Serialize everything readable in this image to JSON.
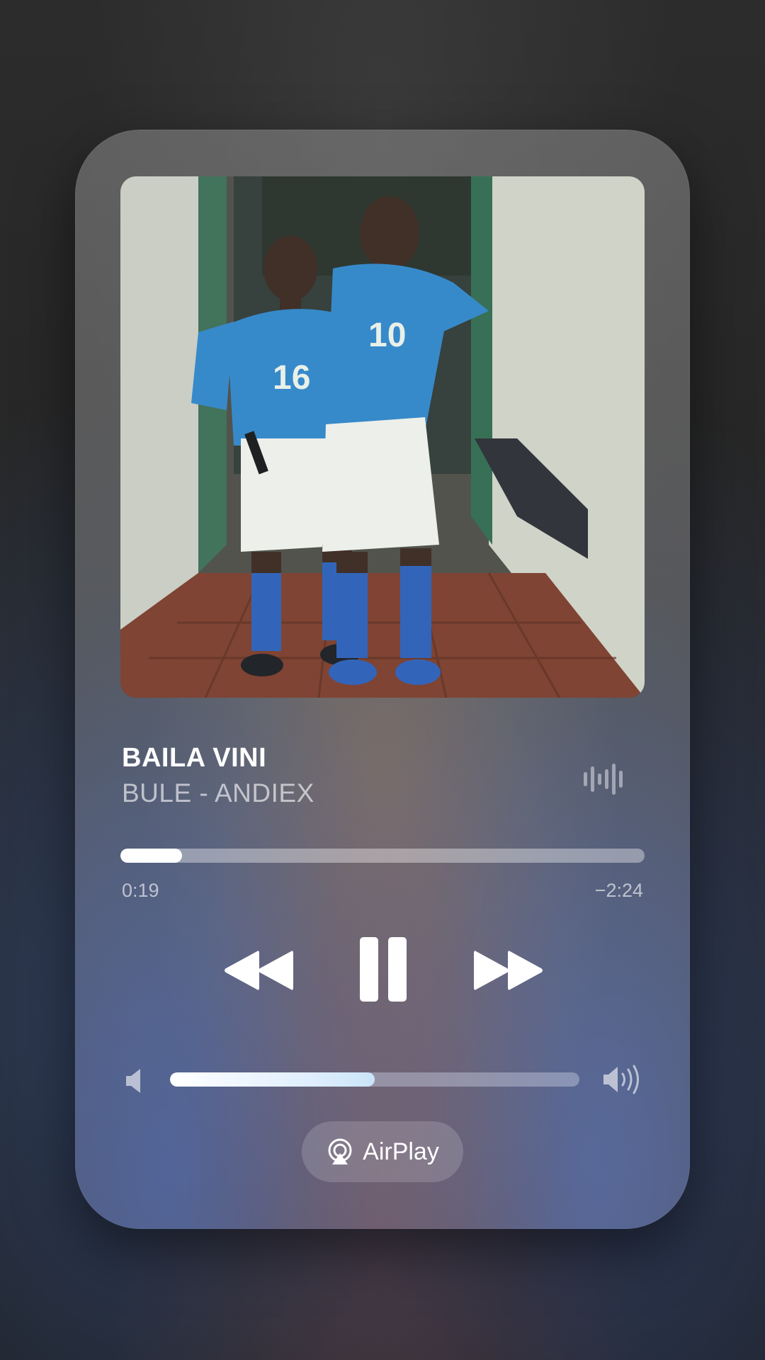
{
  "now_playing": {
    "title": "BAILA VINI",
    "artist": "BULE - ANDIEX",
    "artwork_icon": "album-artwork-photo",
    "elapsed": "0:19",
    "remaining": "−2:24",
    "progress_fraction": 0.117
  },
  "controls": {
    "rewind_icon": "rewind-icon",
    "pause_icon": "pause-icon",
    "forward_icon": "fast-forward-icon"
  },
  "volume": {
    "level_fraction": 0.5,
    "low_icon": "speaker-low-icon",
    "high_icon": "speaker-high-icon"
  },
  "airplay": {
    "label": "AirPlay",
    "icon": "airplay-icon"
  },
  "colors": {
    "text_primary": "#ffffff",
    "text_secondary": "rgba(255,255,255,0.62)",
    "jersey_blue": "#2f86c8"
  }
}
